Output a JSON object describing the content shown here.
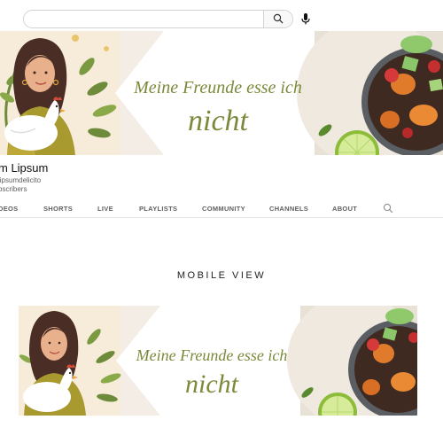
{
  "search": {
    "value": "",
    "placeholder": ""
  },
  "banner": {
    "line1": "Meine Freunde esse ich",
    "line2": "nicht"
  },
  "channel": {
    "name": "m Lipsum",
    "handle": "lipsumdelicito",
    "subscribers": "bscribers"
  },
  "tabs": [
    {
      "label": "DEOS"
    },
    {
      "label": "SHORTS"
    },
    {
      "label": "LIVE"
    },
    {
      "label": "PLAYLISTS"
    },
    {
      "label": "COMMUNITY"
    },
    {
      "label": "CHANNELS"
    },
    {
      "label": "ABOUT"
    }
  ],
  "section": {
    "title": "MOBILE VIEW"
  },
  "colors": {
    "accent_green": "#7a8a3a",
    "banner_bg": "#f4eee7",
    "tab_text": "#606060"
  },
  "icons": [
    "close-icon",
    "search-icon",
    "microphone-icon",
    "tab-search-icon"
  ]
}
